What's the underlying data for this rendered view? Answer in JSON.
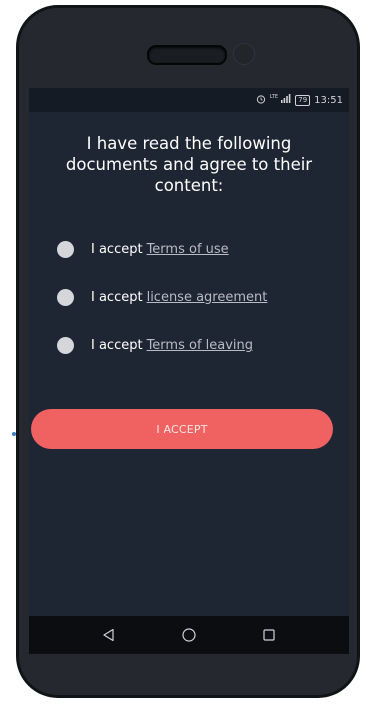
{
  "status_bar": {
    "alarm_icon": "alarm-clock-icon",
    "signal_icon": "lte-signal-icon",
    "signal_text": "LTE",
    "battery_level": "79",
    "time": "13:51"
  },
  "title": "I have read the following documents and agree to their content:",
  "options": [
    {
      "prefix": "I accept",
      "link": "Terms of use",
      "checked": false
    },
    {
      "prefix": "I accept",
      "link": "license agreement",
      "checked": false
    },
    {
      "prefix": "I accept",
      "link": "Terms of leaving",
      "checked": false
    }
  ],
  "accept_button": {
    "label": "I ACCEPT"
  },
  "navigation": {
    "back_icon": "back-triangle-icon",
    "home_icon": "home-circle-icon",
    "recents_icon": "recents-square-icon"
  },
  "colors": {
    "screen_background": "#1e2533",
    "accent": "#f06262",
    "radio": "#d5d6d9"
  }
}
